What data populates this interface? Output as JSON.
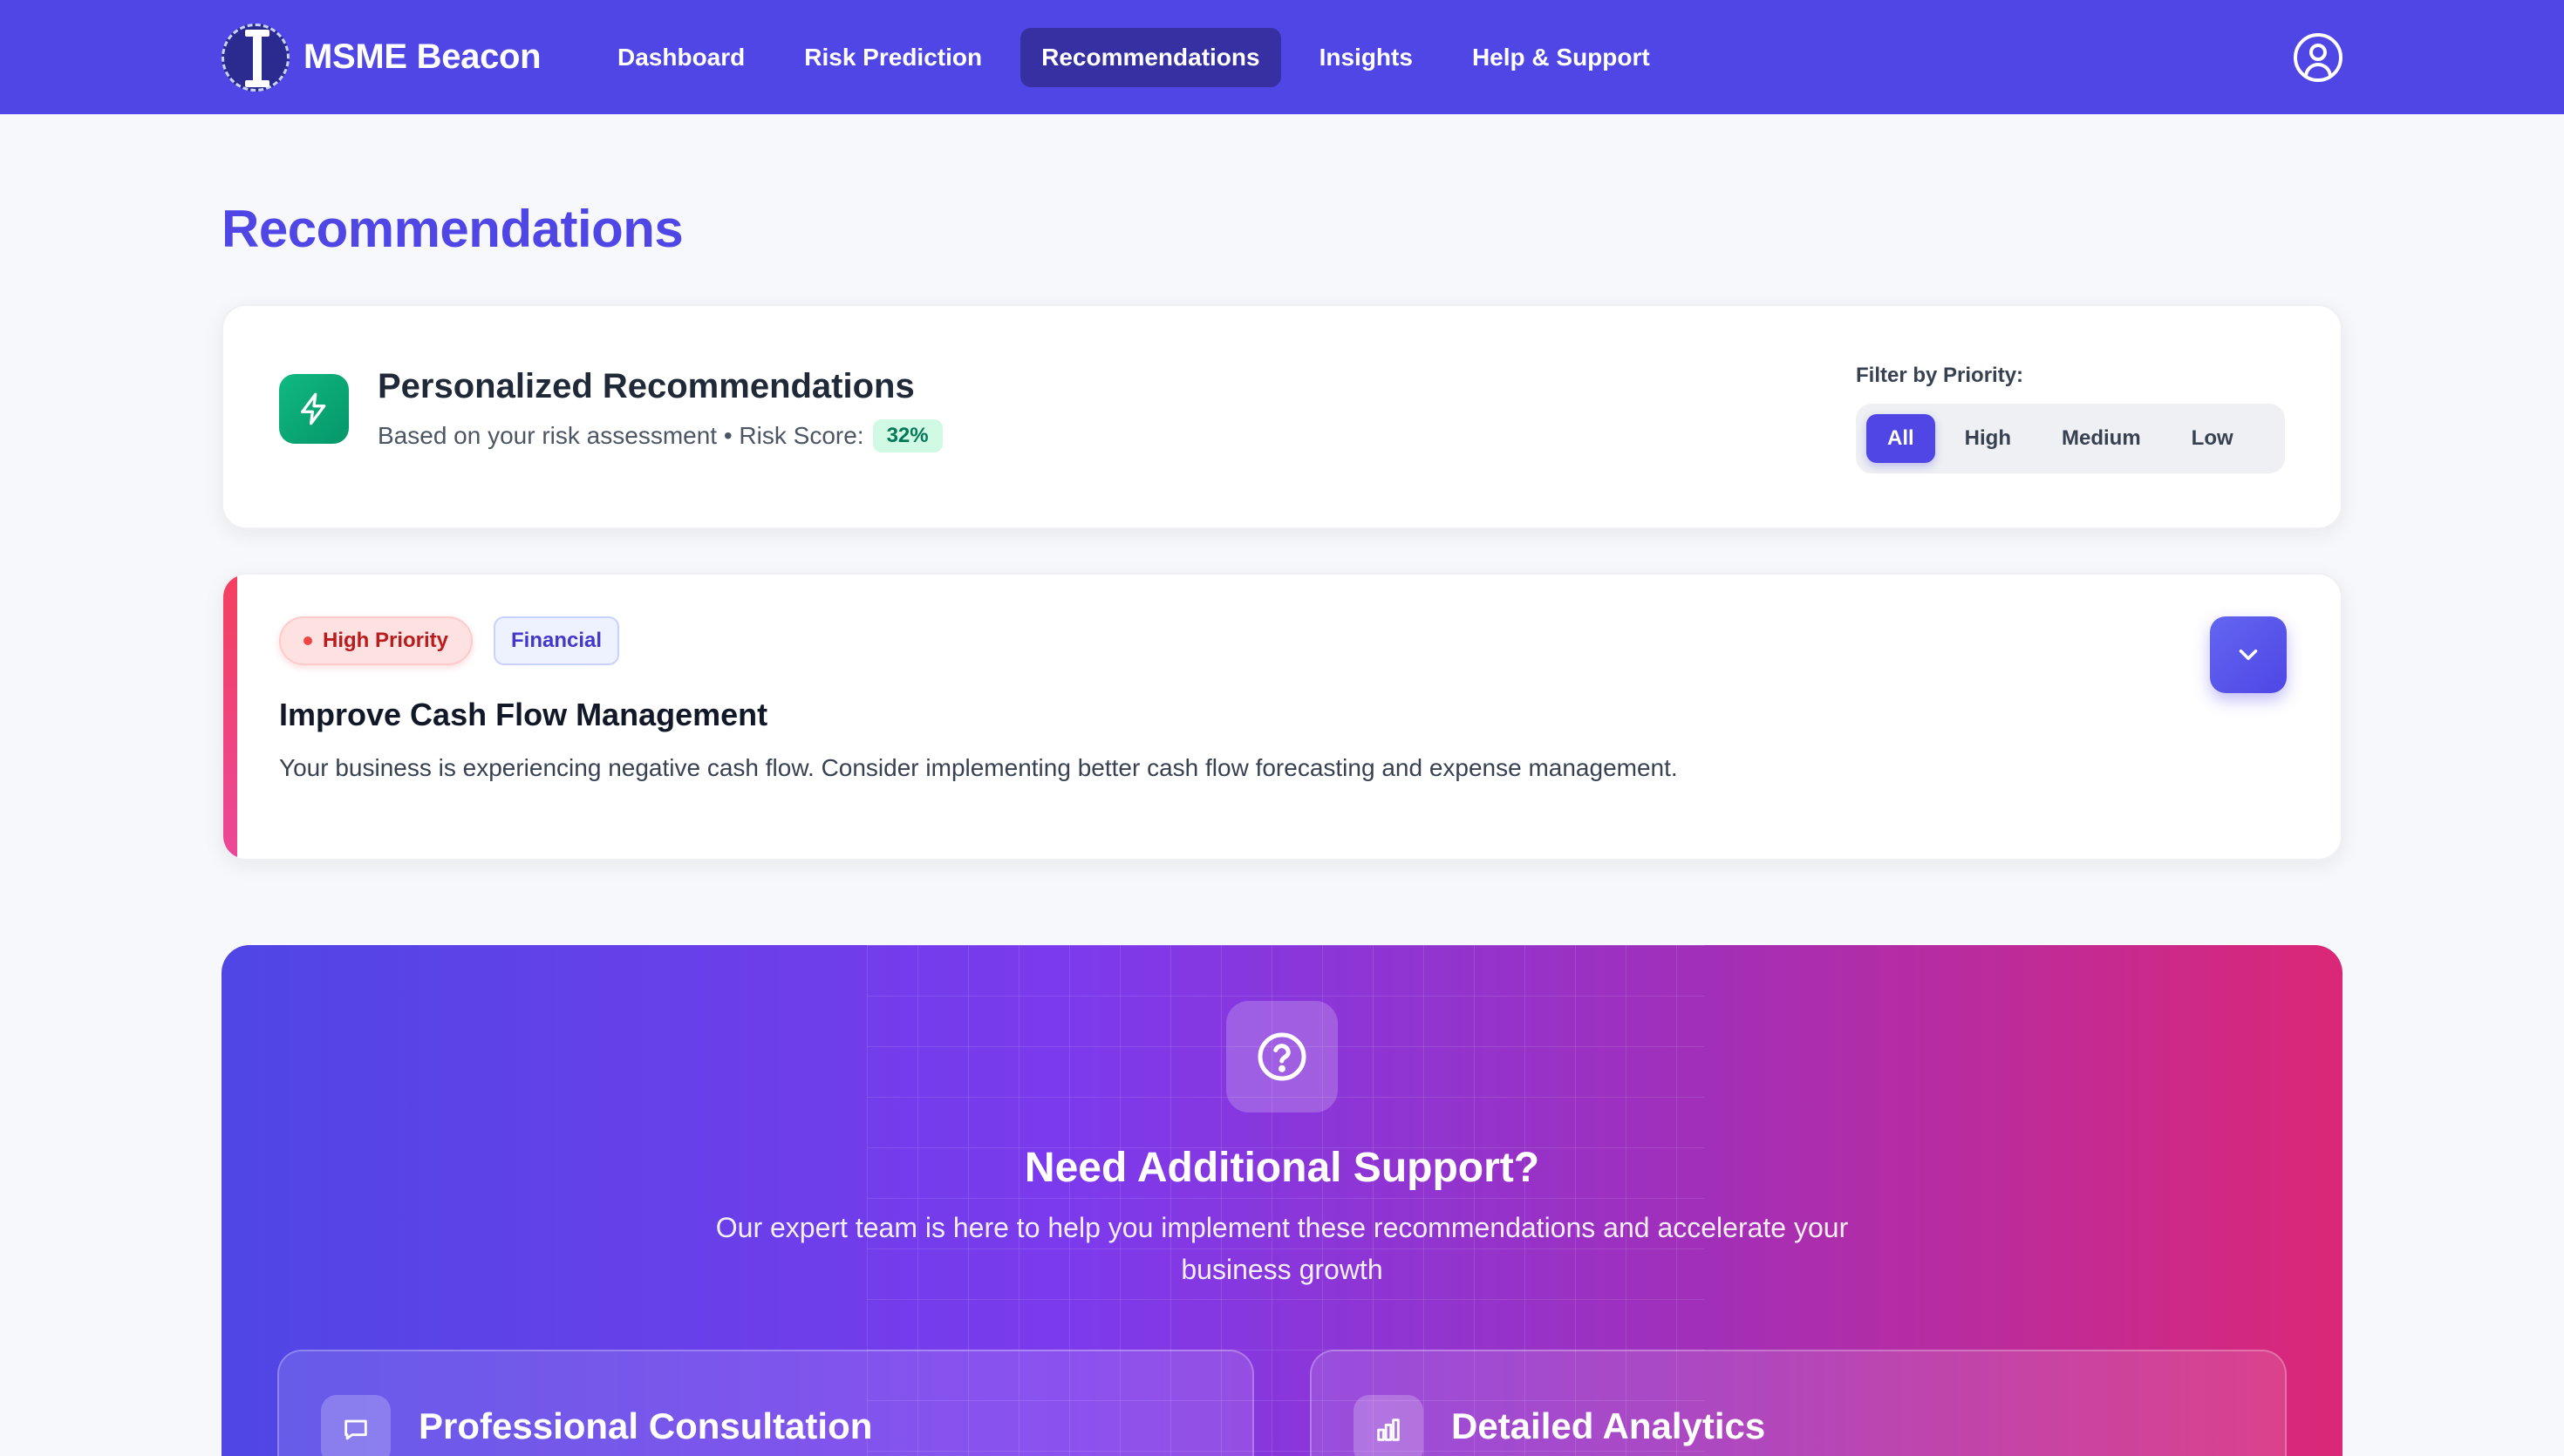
{
  "brand": {
    "name": "MSME Beacon"
  },
  "nav": {
    "items": [
      {
        "label": "Dashboard"
      },
      {
        "label": "Risk Prediction"
      },
      {
        "label": "Recommendations"
      },
      {
        "label": "Insights"
      },
      {
        "label": "Help & Support"
      }
    ],
    "active": "Recommendations"
  },
  "page": {
    "title": "Recommendations"
  },
  "personalized": {
    "title": "Personalized Recommendations",
    "subtitle": "Based on your risk assessment • Risk Score:",
    "risk_score": "32%",
    "filter_label": "Filter by Priority:",
    "filters": [
      "All",
      "High",
      "Medium",
      "Low"
    ],
    "active_filter": "All"
  },
  "recommendation": {
    "priority": "High Priority",
    "category": "Financial",
    "title": "Improve Cash Flow Management",
    "description": "Your business is experiencing negative cash flow. Consider implementing better cash flow forecasting and expense management."
  },
  "support": {
    "title": "Need Additional Support?",
    "text": "Our expert team is here to help you implement these recommendations and accelerate your business growth",
    "features": [
      {
        "title": "Professional Consultation",
        "icon": "chat-icon"
      },
      {
        "title": "Detailed Analytics",
        "icon": "bar-chart-icon"
      }
    ]
  },
  "colors": {
    "primary": "#4f46e5",
    "active_nav": "#3730a3",
    "success": "#10b981",
    "danger": "#ef4444",
    "banner_end": "#db2777"
  }
}
